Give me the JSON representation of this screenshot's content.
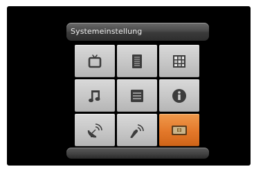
{
  "menu": {
    "title": "Systemeinstellung",
    "items": [
      {
        "icon": "tv-icon"
      },
      {
        "icon": "list-icon"
      },
      {
        "icon": "grid-icon"
      },
      {
        "icon": "music-note-icon"
      },
      {
        "icon": "text-lines-icon"
      },
      {
        "icon": "info-icon"
      },
      {
        "icon": "satellite-dish-icon"
      },
      {
        "icon": "signal-antenna-icon"
      },
      {
        "icon": "ci-card-icon"
      }
    ],
    "selected_index": 8
  },
  "colors": {
    "screen_background": "#000000",
    "tile_background": "#c6c6c6",
    "tile_selected": "#e3782a",
    "icon_color": "#3c3c3c",
    "title_text": "#ececec"
  }
}
